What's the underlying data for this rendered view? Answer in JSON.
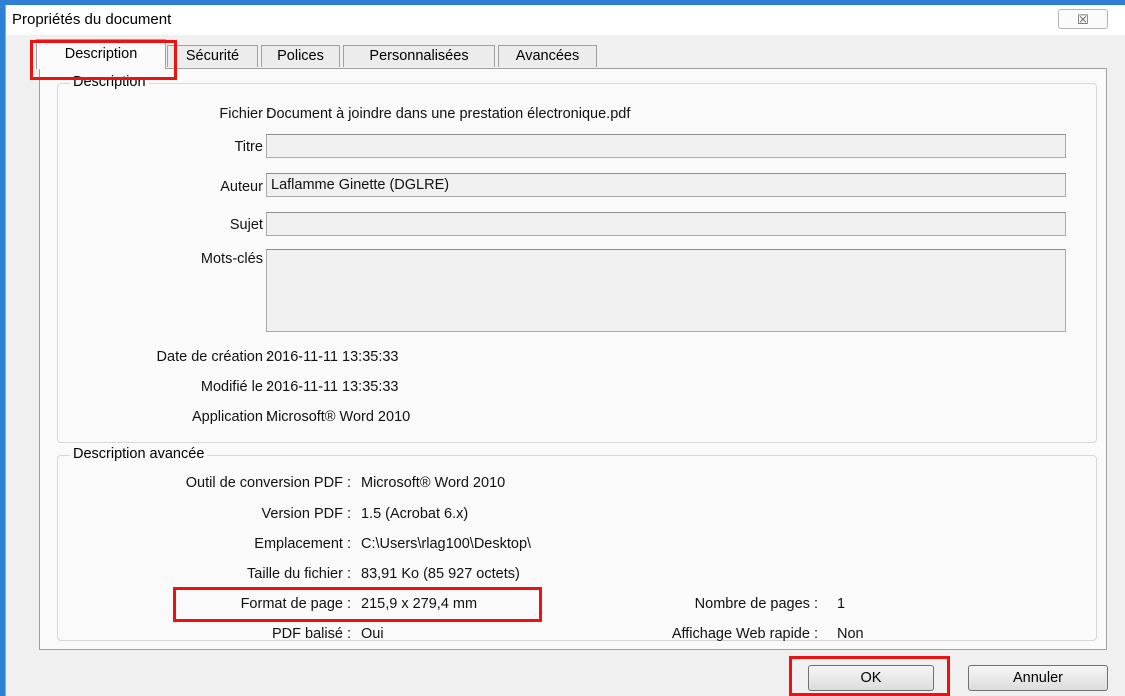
{
  "window": {
    "title": "Propriétés du document",
    "close_label": "☒"
  },
  "tabs": [
    {
      "label": "Description"
    },
    {
      "label": "Sécurité"
    },
    {
      "label": "Polices"
    },
    {
      "label": "Personnalisées"
    },
    {
      "label": "Avancées"
    }
  ],
  "description": {
    "legend": "Description",
    "fichier_label": "Fichier :",
    "fichier_value": "Document à joindre dans une prestation électronique.pdf",
    "titre_label": "Titre :",
    "titre_value": "",
    "auteur_label": "Auteur :",
    "auteur_value": "Laflamme Ginette (DGLRE)",
    "sujet_label": "Sujet :",
    "sujet_value": "",
    "mots_label": "Mots-clés :",
    "mots_value": "",
    "creation_label": "Date de création :",
    "creation_value": "2016-11-11 13:35:33",
    "modifie_label": "Modifié le :",
    "modifie_value": "2016-11-11 13:35:33",
    "application_label": "Application :",
    "application_value": "Microsoft® Word 2010"
  },
  "advanced": {
    "legend": "Description avancée",
    "outil_label": "Outil de conversion PDF :",
    "outil_value": "Microsoft® Word 2010",
    "version_label": "Version PDF :",
    "version_value": "1.5 (Acrobat 6.x)",
    "emplacement_label": "Emplacement :",
    "emplacement_value": "C:\\Users\\rlag100\\Desktop\\",
    "taille_label": "Taille du fichier :",
    "taille_value": "83,91 Ko (85 927 octets)",
    "format_label": "Format de page :",
    "format_value": "215,9 x 279,4 mm",
    "nbpages_label": "Nombre de pages :",
    "nbpages_value": "1",
    "balise_label": "PDF balisé :",
    "balise_value": "Oui",
    "web_label": "Affichage Web rapide :",
    "web_value": "Non"
  },
  "buttons": {
    "ok": "OK",
    "cancel": "Annuler"
  },
  "colors": {
    "highlight": "#e11111",
    "window_border": "#2f7fd6"
  }
}
